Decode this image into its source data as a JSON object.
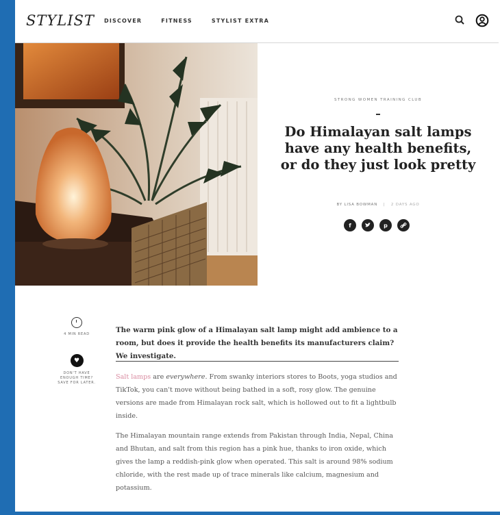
{
  "header": {
    "logo": "STYLIST",
    "nav": [
      "DISCOVER",
      "FITNESS",
      "STYLIST EXTRA"
    ]
  },
  "article": {
    "kicker": "STRONG WOMEN TRAINING CLUB",
    "title": "Do Himalayan salt lamps have any health benefits, or do they just look pretty",
    "byline_author": "BY LISA BOWMAN",
    "byline_date": "2 DAYS AGO",
    "share_icons": [
      "facebook-icon",
      "twitter-icon",
      "pinterest-icon",
      "link-icon"
    ],
    "read_time": "4 MIN READ",
    "save_prompt": "DON'T HAVE ENOUGH TIME? SAVE FOR LATER.",
    "standfirst": "The warm pink glow of a Himalayan salt lamp might add ambience to a room, but does it provide the health benefits its manufacturers claim? We investigate.",
    "p1_link": "Salt lamps",
    "p1_mid": " are ",
    "p1_em": "everywhere",
    "p1_rest": ". From swanky interiors stores to Boots, yoga studios and TikTok, you can't move without being bathed in a soft, rosy glow. The genuine versions are made from Himalayan rock salt, which is hollowed out to fit a lightbulb inside.",
    "p2": "The Himalayan mountain range extends from Pakistan through India, Nepal, China and Bhutan, and salt from this region has a pink hue, thanks to iron oxide, which gives the lamp a reddish-pink glow when operated. This salt is around 98% sodium chloride, with the rest made up of trace minerals like calcium, magnesium and potassium."
  },
  "colors": {
    "frame_blue": "#1f6db3",
    "link_pink": "#d98aa0"
  }
}
